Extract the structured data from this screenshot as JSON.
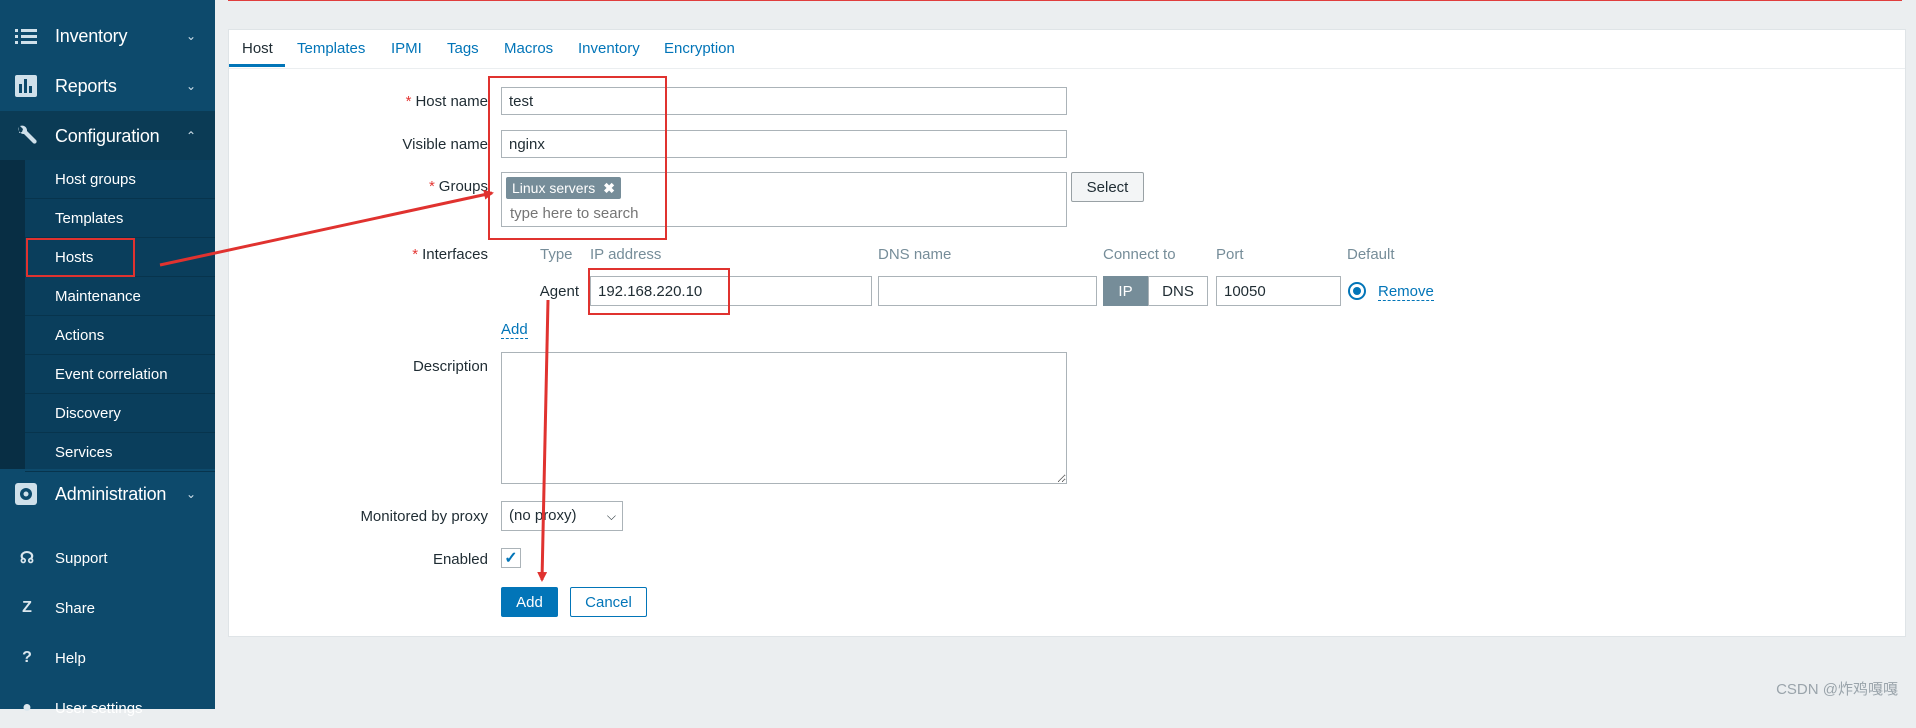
{
  "sidebar": {
    "sections": [
      {
        "label": "Inventory",
        "icon": "list-icon",
        "chevron": "⌄"
      },
      {
        "label": "Reports",
        "icon": "bar-chart-icon",
        "chevron": "⌄"
      },
      {
        "label": "Configuration",
        "icon": "wrench-icon",
        "chevron": "⌃"
      },
      {
        "label": "Administration",
        "icon": "gear-icon",
        "chevron": "⌄"
      }
    ],
    "config_items": [
      "Host groups",
      "Templates",
      "Hosts",
      "Maintenance",
      "Actions",
      "Event correlation",
      "Discovery",
      "Services"
    ],
    "bottom_items": [
      {
        "label": "Support",
        "icon": "headset-icon",
        "glyph": "☊"
      },
      {
        "label": "Share",
        "icon": "share-icon",
        "glyph": "Z"
      },
      {
        "label": "Help",
        "icon": "help-icon",
        "glyph": "?"
      },
      {
        "label": "User settings",
        "icon": "user-icon",
        "glyph": "●"
      }
    ]
  },
  "tabs": [
    "Host",
    "Templates",
    "IPMI",
    "Tags",
    "Macros",
    "Inventory",
    "Encryption"
  ],
  "form": {
    "host_name_label": "Host name",
    "host_name_value": "test",
    "visible_name_label": "Visible name",
    "visible_name_value": "nginx",
    "groups_label": "Groups",
    "group_chip": "Linux servers",
    "groups_placeholder": "type here to search",
    "select_button": "Select",
    "interfaces_label": "Interfaces",
    "iface_headers": {
      "type": "Type",
      "ip": "IP address",
      "dns": "DNS name",
      "connect": "Connect to",
      "port": "Port",
      "default": "Default"
    },
    "iface_type": "Agent",
    "iface_ip": "192.168.220.10",
    "iface_dns": "",
    "connect_ip": "IP",
    "connect_dns": "DNS",
    "iface_port": "10050",
    "remove_link": "Remove",
    "add_link": "Add",
    "description_label": "Description",
    "description_value": "",
    "proxy_label": "Monitored by proxy",
    "proxy_value": "(no proxy)",
    "enabled_label": "Enabled",
    "enabled_check": "✓",
    "add_button": "Add",
    "cancel_button": "Cancel"
  },
  "colors": {
    "accent": "#0275b8",
    "sidebar": "#0d4a6c",
    "annotation": "#e0322f"
  },
  "watermark": "CSDN @炸鸡嘎嘎"
}
